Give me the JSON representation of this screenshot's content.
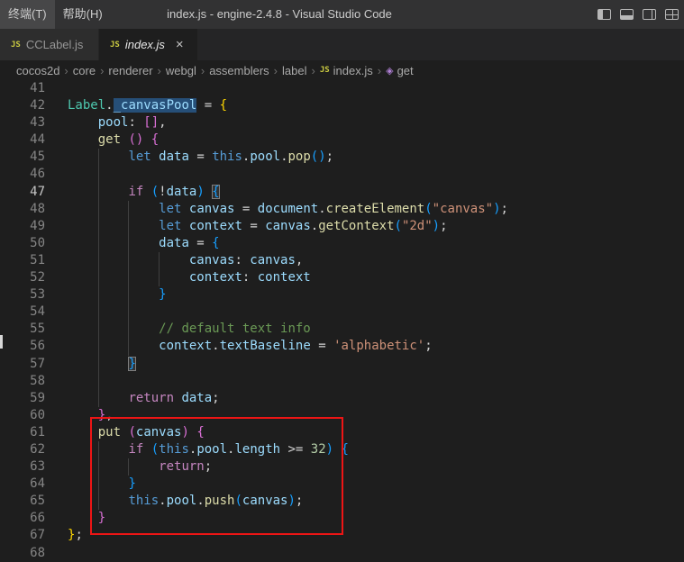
{
  "window": {
    "title": "index.js - engine-2.4.8 - Visual Studio Code",
    "menus": [
      {
        "id": "terminal",
        "label": "终端(T)"
      },
      {
        "id": "help",
        "label": "帮助(H)"
      }
    ]
  },
  "tabs": [
    {
      "label": "CCLabel.js",
      "icon": "JS",
      "active": false,
      "preview": false
    },
    {
      "label": "index.js",
      "icon": "JS",
      "active": true,
      "preview": true,
      "close": "×"
    }
  ],
  "breadcrumb": {
    "separator": "›",
    "path": [
      "cocos2d",
      "core",
      "renderer",
      "webgl",
      "assemblers",
      "label"
    ],
    "file": {
      "label": "index.js",
      "icon": "JS"
    },
    "symbol": {
      "label": "get",
      "icon": "◈"
    }
  },
  "editor": {
    "active_line": 47,
    "lines": [
      {
        "n": 41,
        "guides": [],
        "tokens": []
      },
      {
        "n": 42,
        "guides": [],
        "tokens": [
          {
            "t": "Label",
            "c": "cls"
          },
          {
            "t": ".",
            "c": "fg"
          },
          {
            "t": "_canvasPool",
            "c": "var",
            "sel": true
          },
          {
            "t": " = ",
            "c": "fg"
          },
          {
            "t": "{",
            "c": "b1"
          }
        ]
      },
      {
        "n": 43,
        "guides": [],
        "tokens": [
          {
            "t": "    ",
            "c": "fg"
          },
          {
            "t": "pool",
            "c": "var"
          },
          {
            "t": ": ",
            "c": "fg"
          },
          {
            "t": "[]",
            "c": "b2"
          },
          {
            "t": ",",
            "c": "fg"
          }
        ]
      },
      {
        "n": 44,
        "guides": [],
        "tokens": [
          {
            "t": "    ",
            "c": "fg"
          },
          {
            "t": "get",
            "c": "fn"
          },
          {
            "t": " ",
            "c": "fg"
          },
          {
            "t": "()",
            "c": "b2"
          },
          {
            "t": " ",
            "c": "fg"
          },
          {
            "t": "{",
            "c": "b2"
          }
        ]
      },
      {
        "n": 45,
        "guides": [
          4
        ],
        "tokens": [
          {
            "t": "        ",
            "c": "fg"
          },
          {
            "t": "let",
            "c": "kw"
          },
          {
            "t": " ",
            "c": "fg"
          },
          {
            "t": "data",
            "c": "var"
          },
          {
            "t": " = ",
            "c": "fg"
          },
          {
            "t": "this",
            "c": "kw"
          },
          {
            "t": ".",
            "c": "fg"
          },
          {
            "t": "pool",
            "c": "var"
          },
          {
            "t": ".",
            "c": "fg"
          },
          {
            "t": "pop",
            "c": "fn"
          },
          {
            "t": "()",
            "c": "b3"
          },
          {
            "t": ";",
            "c": "fg"
          }
        ]
      },
      {
        "n": 46,
        "guides": [
          4
        ],
        "tokens": []
      },
      {
        "n": 47,
        "guides": [
          4
        ],
        "tokens": [
          {
            "t": "        ",
            "c": "fg"
          },
          {
            "t": "if",
            "c": "ctl"
          },
          {
            "t": " ",
            "c": "fg"
          },
          {
            "t": "(",
            "c": "b3"
          },
          {
            "t": "!",
            "c": "fg"
          },
          {
            "t": "data",
            "c": "var"
          },
          {
            "t": ")",
            "c": "b3"
          },
          {
            "t": " ",
            "c": "fg"
          },
          {
            "t": "{",
            "c": "b3",
            "m": true
          }
        ]
      },
      {
        "n": 48,
        "guides": [
          4,
          8
        ],
        "tokens": [
          {
            "t": "            ",
            "c": "fg"
          },
          {
            "t": "let",
            "c": "kw"
          },
          {
            "t": " ",
            "c": "fg"
          },
          {
            "t": "canvas",
            "c": "var"
          },
          {
            "t": " = ",
            "c": "fg"
          },
          {
            "t": "document",
            "c": "var"
          },
          {
            "t": ".",
            "c": "fg"
          },
          {
            "t": "createElement",
            "c": "fn"
          },
          {
            "t": "(",
            "c": "b3"
          },
          {
            "t": "\"canvas\"",
            "c": "str"
          },
          {
            "t": ")",
            "c": "b3"
          },
          {
            "t": ";",
            "c": "fg"
          }
        ]
      },
      {
        "n": 49,
        "guides": [
          4,
          8
        ],
        "tokens": [
          {
            "t": "            ",
            "c": "fg"
          },
          {
            "t": "let",
            "c": "kw"
          },
          {
            "t": " ",
            "c": "fg"
          },
          {
            "t": "context",
            "c": "var"
          },
          {
            "t": " = ",
            "c": "fg"
          },
          {
            "t": "canvas",
            "c": "var"
          },
          {
            "t": ".",
            "c": "fg"
          },
          {
            "t": "getContext",
            "c": "fn"
          },
          {
            "t": "(",
            "c": "b3"
          },
          {
            "t": "\"2d\"",
            "c": "str"
          },
          {
            "t": ")",
            "c": "b3"
          },
          {
            "t": ";",
            "c": "fg"
          }
        ]
      },
      {
        "n": 50,
        "guides": [
          4,
          8
        ],
        "tokens": [
          {
            "t": "            ",
            "c": "fg"
          },
          {
            "t": "data",
            "c": "var"
          },
          {
            "t": " = ",
            "c": "fg"
          },
          {
            "t": "{",
            "c": "b3"
          }
        ]
      },
      {
        "n": 51,
        "guides": [
          4,
          8,
          12
        ],
        "tokens": [
          {
            "t": "                ",
            "c": "fg"
          },
          {
            "t": "canvas",
            "c": "var"
          },
          {
            "t": ": ",
            "c": "fg"
          },
          {
            "t": "canvas",
            "c": "var"
          },
          {
            "t": ",",
            "c": "fg"
          }
        ]
      },
      {
        "n": 52,
        "guides": [
          4,
          8,
          12
        ],
        "tokens": [
          {
            "t": "                ",
            "c": "fg"
          },
          {
            "t": "context",
            "c": "var"
          },
          {
            "t": ": ",
            "c": "fg"
          },
          {
            "t": "context",
            "c": "var"
          }
        ]
      },
      {
        "n": 53,
        "guides": [
          4,
          8
        ],
        "tokens": [
          {
            "t": "            ",
            "c": "fg"
          },
          {
            "t": "}",
            "c": "b3"
          }
        ]
      },
      {
        "n": 54,
        "guides": [
          4,
          8
        ],
        "tokens": []
      },
      {
        "n": 55,
        "guides": [
          4,
          8
        ],
        "tokens": [
          {
            "t": "            ",
            "c": "fg"
          },
          {
            "t": "// default text info",
            "c": "com"
          }
        ]
      },
      {
        "n": 56,
        "guides": [
          4,
          8
        ],
        "tokens": [
          {
            "t": "            ",
            "c": "fg"
          },
          {
            "t": "context",
            "c": "var"
          },
          {
            "t": ".",
            "c": "fg"
          },
          {
            "t": "textBaseline",
            "c": "var"
          },
          {
            "t": " = ",
            "c": "fg"
          },
          {
            "t": "'alphabetic'",
            "c": "str"
          },
          {
            "t": ";",
            "c": "fg"
          }
        ]
      },
      {
        "n": 57,
        "guides": [
          4
        ],
        "tokens": [
          {
            "t": "        ",
            "c": "fg"
          },
          {
            "t": "}",
            "c": "b3",
            "m": true
          }
        ]
      },
      {
        "n": 58,
        "guides": [
          4
        ],
        "tokens": []
      },
      {
        "n": 59,
        "guides": [
          4
        ],
        "tokens": [
          {
            "t": "        ",
            "c": "fg"
          },
          {
            "t": "return",
            "c": "ctl"
          },
          {
            "t": " ",
            "c": "fg"
          },
          {
            "t": "data",
            "c": "var"
          },
          {
            "t": ";",
            "c": "fg"
          }
        ]
      },
      {
        "n": 60,
        "guides": [],
        "tokens": [
          {
            "t": "    ",
            "c": "fg"
          },
          {
            "t": "}",
            "c": "b2"
          },
          {
            "t": ",",
            "c": "fg"
          }
        ]
      },
      {
        "n": 61,
        "guides": [],
        "tokens": [
          {
            "t": "    ",
            "c": "fg"
          },
          {
            "t": "put",
            "c": "fn"
          },
          {
            "t": " ",
            "c": "fg"
          },
          {
            "t": "(",
            "c": "b2"
          },
          {
            "t": "canvas",
            "c": "var"
          },
          {
            "t": ")",
            "c": "b2"
          },
          {
            "t": " ",
            "c": "fg"
          },
          {
            "t": "{",
            "c": "b2"
          }
        ]
      },
      {
        "n": 62,
        "guides": [
          4
        ],
        "tokens": [
          {
            "t": "        ",
            "c": "fg"
          },
          {
            "t": "if",
            "c": "ctl"
          },
          {
            "t": " ",
            "c": "fg"
          },
          {
            "t": "(",
            "c": "b3"
          },
          {
            "t": "this",
            "c": "kw"
          },
          {
            "t": ".",
            "c": "fg"
          },
          {
            "t": "pool",
            "c": "var"
          },
          {
            "t": ".",
            "c": "fg"
          },
          {
            "t": "length",
            "c": "var"
          },
          {
            "t": " >= ",
            "c": "fg"
          },
          {
            "t": "32",
            "c": "num"
          },
          {
            "t": ")",
            "c": "b3"
          },
          {
            "t": " ",
            "c": "fg"
          },
          {
            "t": "{",
            "c": "b3"
          }
        ]
      },
      {
        "n": 63,
        "guides": [
          4,
          8
        ],
        "tokens": [
          {
            "t": "            ",
            "c": "fg"
          },
          {
            "t": "return",
            "c": "ctl"
          },
          {
            "t": ";",
            "c": "fg"
          }
        ]
      },
      {
        "n": 64,
        "guides": [
          4
        ],
        "tokens": [
          {
            "t": "        ",
            "c": "fg"
          },
          {
            "t": "}",
            "c": "b3"
          }
        ]
      },
      {
        "n": 65,
        "guides": [
          4
        ],
        "tokens": [
          {
            "t": "        ",
            "c": "fg"
          },
          {
            "t": "this",
            "c": "kw"
          },
          {
            "t": ".",
            "c": "fg"
          },
          {
            "t": "pool",
            "c": "var"
          },
          {
            "t": ".",
            "c": "fg"
          },
          {
            "t": "push",
            "c": "fn"
          },
          {
            "t": "(",
            "c": "b3"
          },
          {
            "t": "canvas",
            "c": "var"
          },
          {
            "t": ")",
            "c": "b3"
          },
          {
            "t": ";",
            "c": "fg"
          }
        ]
      },
      {
        "n": 66,
        "guides": [],
        "tokens": [
          {
            "t": "    ",
            "c": "fg"
          },
          {
            "t": "}",
            "c": "b2"
          }
        ]
      },
      {
        "n": 67,
        "guides": [],
        "tokens": [
          {
            "t": "}",
            "c": "b1"
          },
          {
            "t": ";",
            "c": "fg"
          }
        ]
      },
      {
        "n": 68,
        "guides": [],
        "tokens": []
      }
    ]
  },
  "annotation": {
    "color": "#ed1515",
    "lines": [
      61,
      66
    ]
  },
  "colors": {
    "js_icon": "#cbcb41",
    "method_icon": "#b180d7",
    "selection": "#264f78"
  }
}
